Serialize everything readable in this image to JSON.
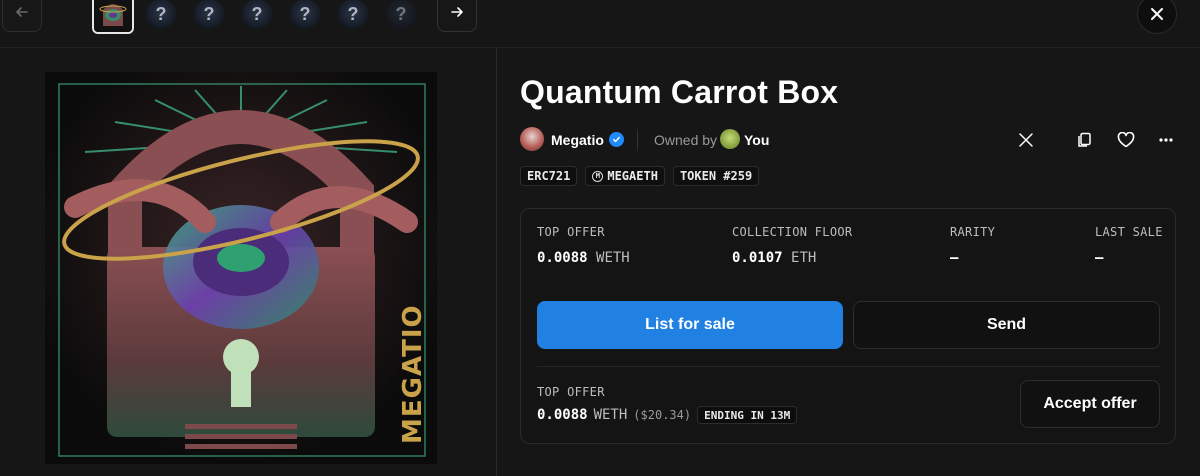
{
  "nav": {
    "prev_icon": "arrow-left-icon",
    "next_icon": "arrow-right-icon",
    "close_icon": "close-icon",
    "thumbnails": [
      {
        "kind": "artwork",
        "active": true
      },
      {
        "kind": "unknown",
        "label": "?"
      },
      {
        "kind": "unknown",
        "label": "?"
      },
      {
        "kind": "unknown",
        "label": "?"
      },
      {
        "kind": "unknown",
        "label": "?"
      },
      {
        "kind": "unknown",
        "label": "?"
      },
      {
        "kind": "unknown",
        "label": "?"
      }
    ]
  },
  "artwork": {
    "watermark_text": "MEGATIO"
  },
  "item": {
    "title": "Quantum Carrot Box",
    "creator": "Megatio",
    "owned_by_label": "Owned by",
    "owner": "You",
    "tags": [
      "ERC721",
      "MEGAETH",
      "TOKEN #259"
    ]
  },
  "stats": [
    {
      "label": "TOP OFFER",
      "value": "0.0088",
      "unit": "WETH"
    },
    {
      "label": "COLLECTION FLOOR",
      "value": "0.0107",
      "unit": "ETH"
    },
    {
      "label": "RARITY",
      "value": "–",
      "unit": ""
    },
    {
      "label": "LAST SALE",
      "value": "–",
      "unit": ""
    }
  ],
  "actions": {
    "list_for_sale": "List for sale",
    "send": "Send",
    "accept_offer": "Accept offer"
  },
  "offer": {
    "label": "TOP OFFER",
    "value": "0.0088",
    "unit": "WETH",
    "usd": "($20.34)",
    "ending": "ENDING IN 13M"
  },
  "colors": {
    "accent": "#2081e2",
    "background": "#161616",
    "card": "#141414"
  }
}
